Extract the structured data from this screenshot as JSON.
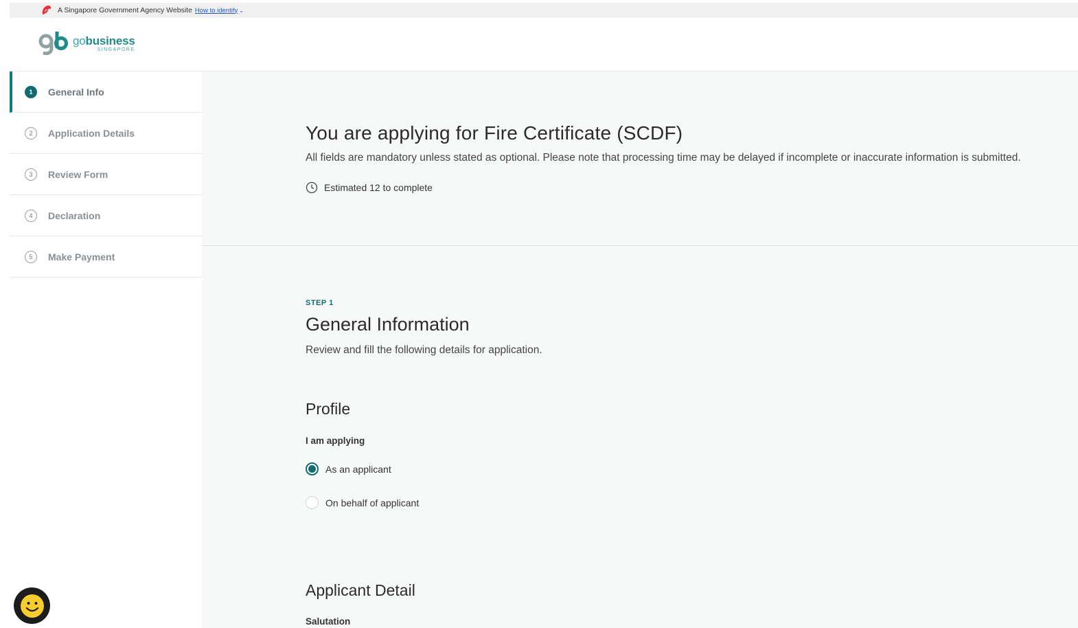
{
  "gov_banner": {
    "text": "A Singapore Government Agency Website",
    "identify_link": "How to identify",
    "chevron": "⌄",
    "icon": "lion-head-icon"
  },
  "header": {
    "logo": {
      "mark": "gb",
      "word_go": "go",
      "word_business": "business",
      "sub": "SINGAPORE"
    }
  },
  "sidebar": {
    "items": [
      {
        "num": "1",
        "label": "General Info",
        "active": true
      },
      {
        "num": "2",
        "label": "Application Details",
        "active": false
      },
      {
        "num": "3",
        "label": "Review Form",
        "active": false
      },
      {
        "num": "4",
        "label": "Declaration",
        "active": false
      },
      {
        "num": "5",
        "label": "Make Payment",
        "active": false
      }
    ]
  },
  "intro": {
    "title": "You are applying for Fire Certificate (SCDF)",
    "description": "All fields are mandatory unless stated as optional. Please note that processing time may be delayed if incomplete or inaccurate information is submitted.",
    "estimate": "Estimated 12 to complete"
  },
  "step": {
    "label": "STEP 1",
    "title": "General Information",
    "description": "Review and fill the following details for application."
  },
  "profile": {
    "heading": "Profile",
    "question": "I am applying",
    "options": [
      {
        "label": "As an applicant",
        "checked": true
      },
      {
        "label": "On behalf of applicant",
        "checked": false
      }
    ]
  },
  "applicant_detail": {
    "heading": "Applicant Detail",
    "salutation_label": "Salutation"
  },
  "colors": {
    "accent": "#0f6b70",
    "banner_bg": "#f0f0f0",
    "main_bg": "#f7f8f8",
    "link": "#1f56c7"
  }
}
